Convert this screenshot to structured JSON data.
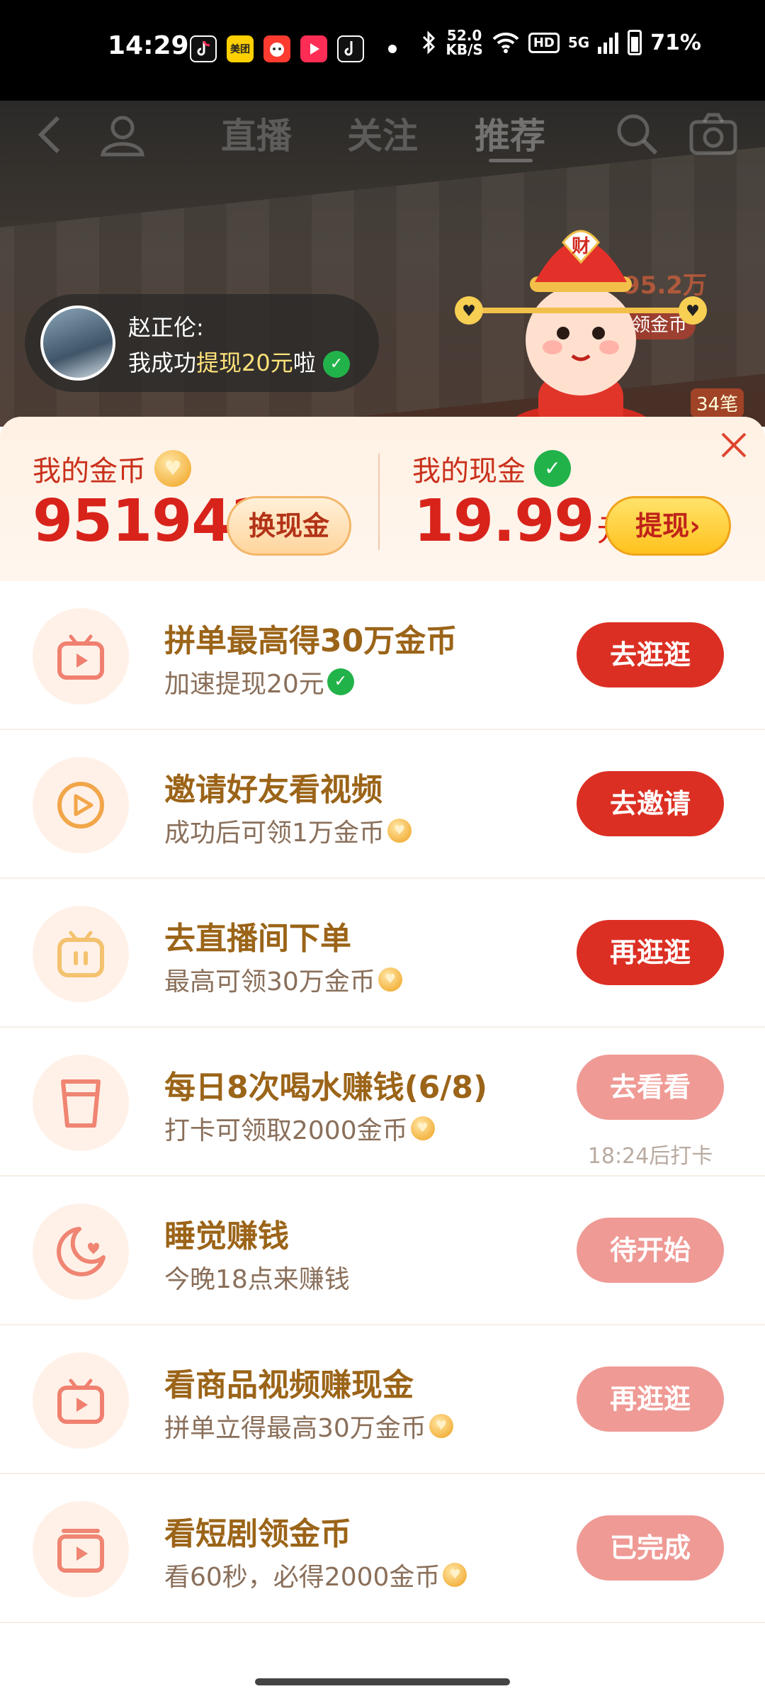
{
  "status_bar": {
    "time": "14:29",
    "app_icons": [
      "tiktok-icon",
      "meituan-icon",
      "red-app-icon",
      "video-app-icon",
      "tiktok-lite-icon"
    ],
    "meituan_label": "美团",
    "net_speed_value": "52.0",
    "net_speed_unit": "KB/S",
    "hd": "HD",
    "network": "5G",
    "battery": "71%"
  },
  "top_nav": {
    "tabs": [
      "直播",
      "关注",
      "推荐"
    ],
    "active_tab": "推荐"
  },
  "toast": {
    "name": "赵正伦:",
    "msg_prefix": "我成功",
    "msg_highlight": "提现20元",
    "msg_suffix": "啦"
  },
  "mascot_badge": "财",
  "right_overlay": {
    "amount": "95.2万",
    "label": "领金币",
    "count": "34笔"
  },
  "wallet": {
    "coins_label": "我的金币",
    "coins_value": "951942",
    "exchange_label": "换现金",
    "cash_label": "我的现金",
    "cash_value": "19.99",
    "cash_unit": "元",
    "withdraw_label": "提现",
    "withdraw_chevron": "›"
  },
  "tasks": [
    {
      "title": "拼单最高得30万金币",
      "subtitle": "加速提现20元",
      "sub_icon": "wechat-check-icon",
      "button": "去逛逛",
      "state": "active",
      "icon": "tv-play-icon"
    },
    {
      "title": "邀请好友看视频",
      "subtitle": "成功后可领1万金币",
      "sub_icon": "gold-coin-icon",
      "button": "去邀请",
      "state": "active",
      "icon": "circle-play-icon"
    },
    {
      "title": "去直播间下单",
      "subtitle": "最高可领30万金币",
      "sub_icon": "gold-coin-icon",
      "button": "再逛逛",
      "state": "active",
      "icon": "live-tv-icon"
    },
    {
      "title": "每日8次喝水赚钱(6/8)",
      "subtitle": "打卡可领取2000金币",
      "sub_icon": "gold-coin-icon",
      "button": "去看看",
      "state": "muted",
      "note": "18:24后打卡",
      "icon": "cup-icon"
    },
    {
      "title": "睡觉赚钱",
      "subtitle": "今晚18点来赚钱",
      "sub_icon": "",
      "button": "待开始",
      "state": "muted",
      "icon": "moon-icon"
    },
    {
      "title": "看商品视频赚现金",
      "subtitle": "拼单立得最高30万金币",
      "sub_icon": "gold-coin-icon",
      "button": "再逛逛",
      "state": "muted",
      "icon": "tv-play-icon"
    },
    {
      "title": "看短剧领金币",
      "subtitle": "看60秒，必得2000金币",
      "sub_icon": "gold-coin-icon",
      "button": "已完成",
      "state": "muted",
      "icon": "drama-play-icon"
    }
  ],
  "colors": {
    "primary_red": "#dc2f23",
    "muted_red": "#ef9a95",
    "title_gold": "#9b6418",
    "wallet_bg": "#fff1e4"
  }
}
